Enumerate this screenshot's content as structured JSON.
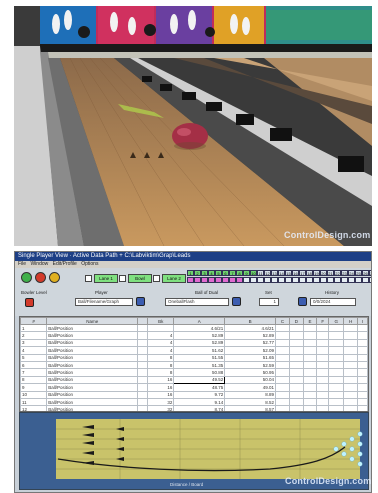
{
  "photo": {
    "watermark": "ControlDesign.com"
  },
  "app": {
    "title": "Single Player View  ·  Active Data Path + C:\\Labviktim\\Grap\\Leads",
    "menu": [
      "File",
      "Window",
      "Edit/Profile",
      "Options"
    ],
    "options": [
      {
        "label": "Lane 1",
        "state": "Lane 1"
      },
      {
        "label": "Bowl",
        "state": "Bowl"
      },
      {
        "label": "Lane 2",
        "state": "Lane 2"
      }
    ],
    "frame_numbers": [
      "1",
      "2",
      "3",
      "4",
      "5",
      "6",
      "7",
      "8",
      "9",
      "10",
      "11",
      "12",
      "13",
      "14",
      "15",
      "16",
      "17",
      "18",
      "19",
      "20",
      "21",
      "22",
      "23",
      "24",
      "25",
      "26",
      "27"
    ],
    "fields": {
      "bowler_label": "Bowler Level",
      "player_label": "Player",
      "player_value": "Ball/Filename/Graph",
      "ball_label": "Ball of Dual",
      "ball_value": "OneballFlash",
      "set_label": "Set",
      "set_value": "1",
      "history_label": "History",
      "history_value": "0/0/2024"
    },
    "table": {
      "headers": [
        "#",
        "Name",
        "",
        "Bk",
        "A",
        "B",
        "C",
        "D",
        "E",
        "F",
        "G",
        "H",
        "I"
      ],
      "rows": [
        [
          "1",
          "Ball/Position",
          "",
          "",
          "4.6/21",
          "4.6/21"
        ],
        [
          "2",
          "Ball/Position",
          "",
          "4",
          "52.89",
          "52.89"
        ],
        [
          "3",
          "Ball/Position",
          "",
          "4",
          "52.89",
          "52.77"
        ],
        [
          "4",
          "Ball/Position",
          "",
          "4",
          "51.62",
          "52.09"
        ],
        [
          "5",
          "Ball/Position",
          "",
          "8",
          "51.55",
          "51.65"
        ],
        [
          "6",
          "Ball/Position",
          "",
          "8",
          "51.35",
          "52.59"
        ],
        [
          "7",
          "Ball/Position",
          "",
          "8",
          "50.88",
          "50.95"
        ],
        [
          "8",
          "Ball/Position",
          "",
          "16",
          "49.52",
          "50.04"
        ],
        [
          "9",
          "Ball/Position",
          "",
          "16",
          "48.75",
          "49.01"
        ],
        [
          "10",
          "Ball/Position",
          "",
          "16",
          "9.72",
          "8.89"
        ],
        [
          "11",
          "Ball/Position",
          "",
          "32",
          "9.14",
          "8.52"
        ],
        [
          "12",
          "Ball/Position",
          "",
          "32",
          "8.74",
          "8.57"
        ],
        [
          "13",
          "Ball/Position",
          "",
          "64",
          "8.06",
          "8.04"
        ],
        [
          "14",
          "Ball/Position",
          "",
          "64",
          "8.88",
          "8.88"
        ]
      ]
    },
    "plot": {
      "xlabel": "Distance / Board",
      "watermark": "ControlDesign.com"
    }
  }
}
